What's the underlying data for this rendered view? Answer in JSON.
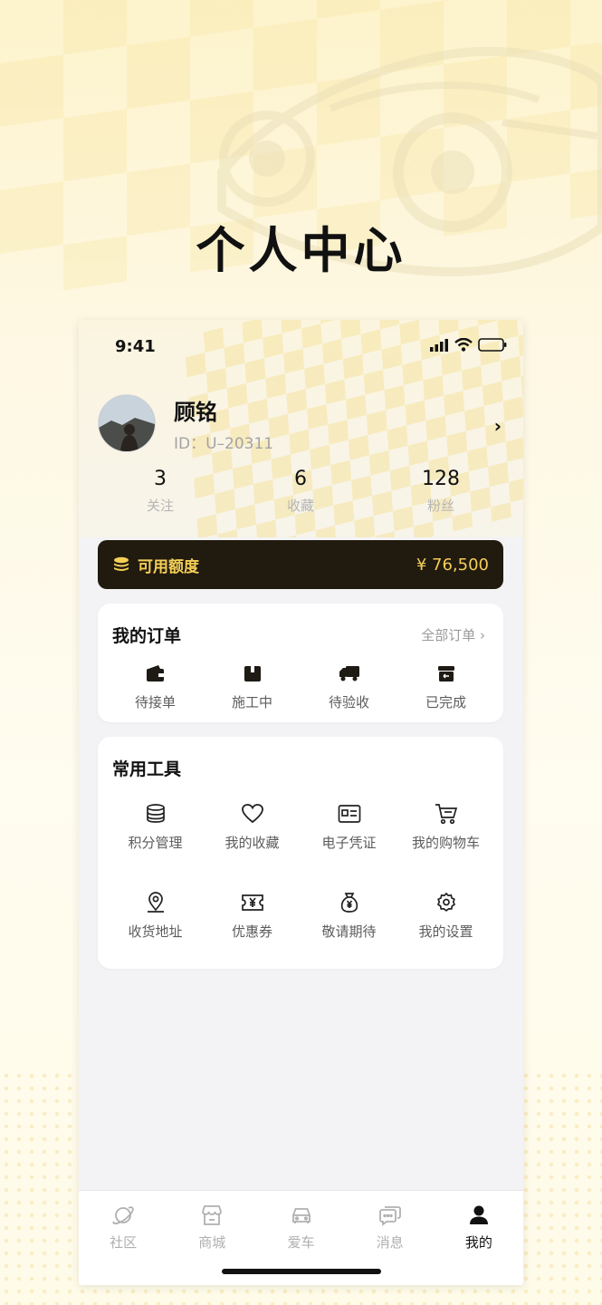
{
  "page_title": "个人中心",
  "status": {
    "time": "9:41"
  },
  "profile": {
    "name": "顾铭",
    "id": "ID：U–20311"
  },
  "stats": [
    {
      "value": "3",
      "label": "关注"
    },
    {
      "value": "6",
      "label": "收藏"
    },
    {
      "value": "128",
      "label": "粉丝"
    }
  ],
  "credit": {
    "label": "可用额度",
    "value": "¥ 76,500"
  },
  "orders": {
    "title": "我的订单",
    "more": "全部订单",
    "items": [
      {
        "label": "待接单",
        "icon": "wallet-icon"
      },
      {
        "label": "施工中",
        "icon": "box-icon"
      },
      {
        "label": "待验收",
        "icon": "truck-icon"
      },
      {
        "label": "已完成",
        "icon": "return-box-icon"
      }
    ]
  },
  "tools": {
    "title": "常用工具",
    "items": [
      {
        "label": "积分管理",
        "icon": "coins-icon"
      },
      {
        "label": "我的收藏",
        "icon": "heart-icon"
      },
      {
        "label": "电子凭证",
        "icon": "id-card-icon"
      },
      {
        "label": "我的购物车",
        "icon": "cart-icon"
      },
      {
        "label": "收货地址",
        "icon": "location-pin-icon"
      },
      {
        "label": "优惠券",
        "icon": "coupon-icon"
      },
      {
        "label": "敬请期待",
        "icon": "money-bag-icon"
      },
      {
        "label": "我的设置",
        "icon": "gear-icon"
      }
    ]
  },
  "tabbar": [
    {
      "label": "社区",
      "icon": "planet-icon",
      "active": false
    },
    {
      "label": "商城",
      "icon": "store-icon",
      "active": false
    },
    {
      "label": "爱车",
      "icon": "car-icon",
      "active": false
    },
    {
      "label": "消息",
      "icon": "chat-icon",
      "active": false
    },
    {
      "label": "我的",
      "icon": "user-icon",
      "active": true
    }
  ],
  "colors": {
    "accent": "#f4cf57",
    "credit_bg": "#211a0f",
    "active_tab": "#111111"
  }
}
